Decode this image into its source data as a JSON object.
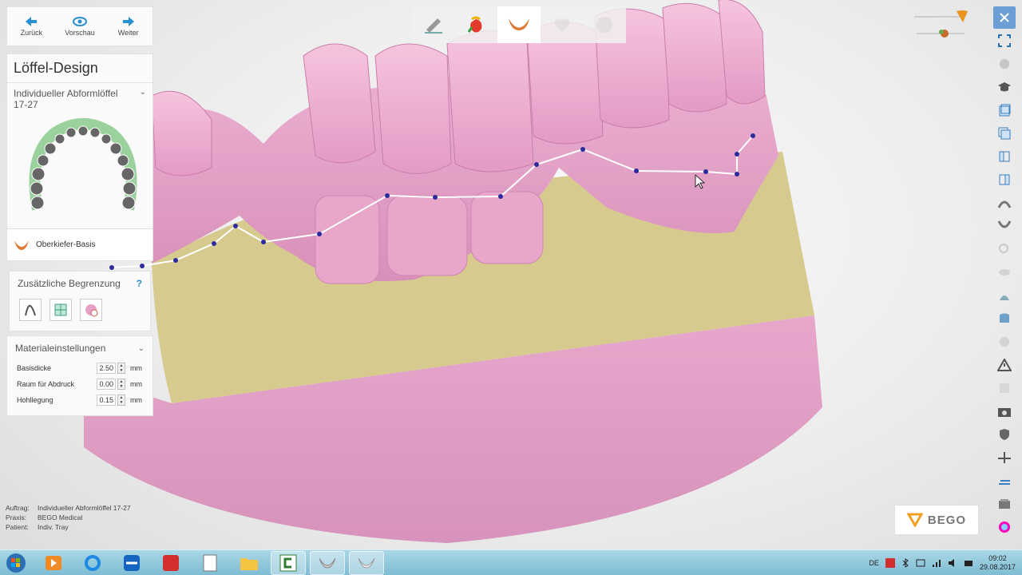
{
  "nav": {
    "back": "Zurück",
    "preview": "Vorschau",
    "next": "Weiter"
  },
  "panel": {
    "title": "Löffel-Design",
    "job_line1": "Individueller Abformlöffel",
    "job_line2": "17-27",
    "basis_label": "Oberkiefer-Basis"
  },
  "boundary": {
    "title": "Zusätzliche Begrenzung",
    "help": "?"
  },
  "material": {
    "title": "Materialeinstellungen",
    "rows": [
      {
        "label": "Basisdicke",
        "value": "2.50",
        "unit": "mm"
      },
      {
        "label": "Raum für Abdruck",
        "value": "0.00",
        "unit": "mm"
      },
      {
        "label": "Hohllegung",
        "value": "0.15",
        "unit": "mm"
      }
    ]
  },
  "info": {
    "order_k": "Auftrag:",
    "order_v": "Individueller Abformlöffel 17-27",
    "practice_k": "Praxis:",
    "practice_v": "BEGO Medical",
    "patient_k": "Patient:",
    "patient_v": "Indiv. Tray"
  },
  "logo": "BEGO",
  "taskbar": {
    "lang": "DE",
    "time": "09:02",
    "date": "29.08.2017"
  },
  "colors": {
    "accent": "#2a8fd1",
    "gum_pink": "#e6a2c6",
    "tray_yellow": "#d6ca8e",
    "spline": "#2b2b9e",
    "taskbar": "#9ccfe1"
  }
}
